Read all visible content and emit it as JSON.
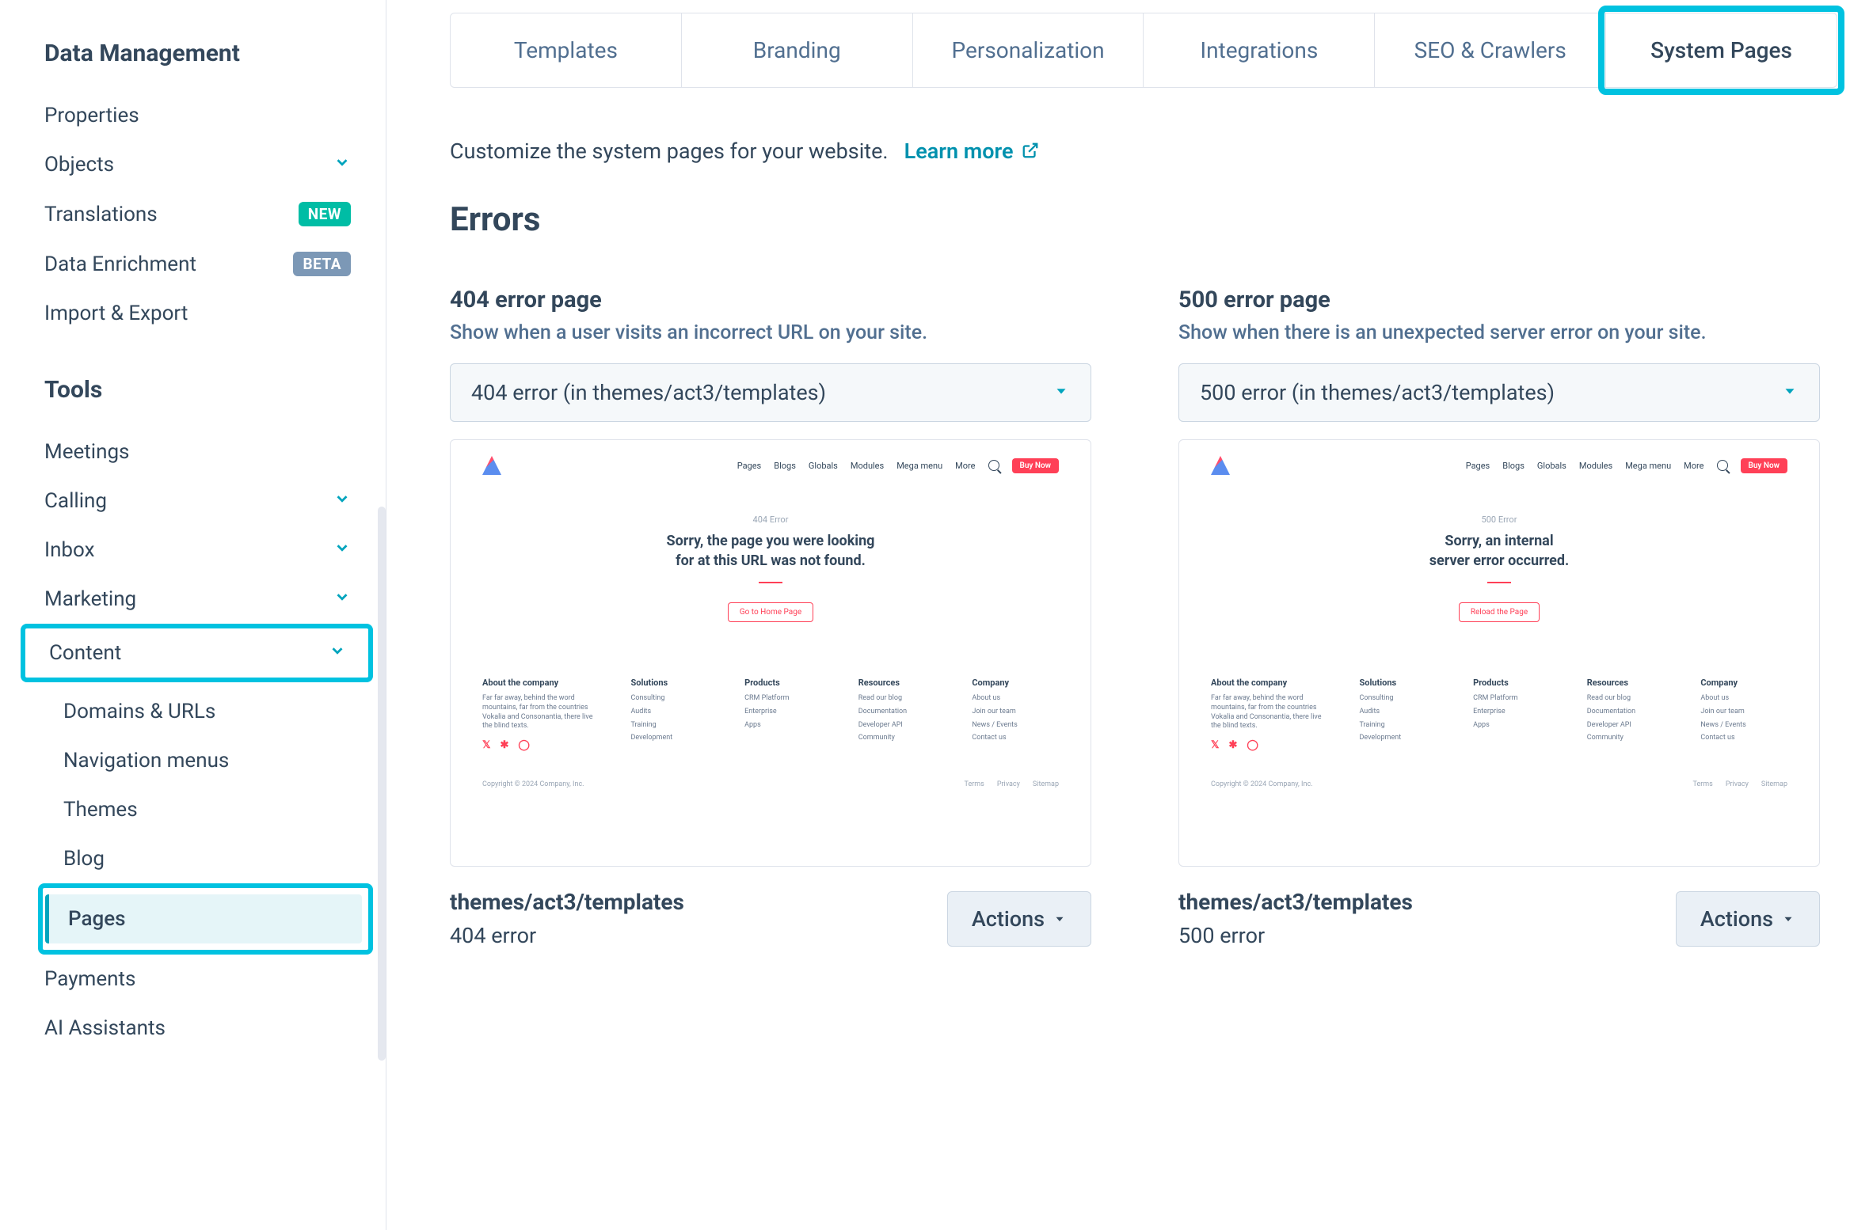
{
  "sidebar": {
    "section1_heading": "Data Management",
    "items1": {
      "properties": "Properties",
      "objects": "Objects",
      "translations": "Translations",
      "translations_badge": "NEW",
      "data_enrichment": "Data Enrichment",
      "data_enrichment_badge": "BETA",
      "import_export": "Import & Export"
    },
    "section2_heading": "Tools",
    "items2": {
      "meetings": "Meetings",
      "calling": "Calling",
      "inbox": "Inbox",
      "marketing": "Marketing",
      "content": "Content",
      "payments": "Payments",
      "ai_assistants": "AI Assistants"
    },
    "content_sub": {
      "domains": "Domains & URLs",
      "navmenus": "Navigation menus",
      "themes": "Themes",
      "blog": "Blog",
      "pages": "Pages"
    }
  },
  "tabs": {
    "templates": "Templates",
    "branding": "Branding",
    "personalization": "Personalization",
    "integrations": "Integrations",
    "seo": "SEO & Crawlers",
    "system_pages": "System Pages"
  },
  "main": {
    "description": "Customize the system pages for your website.",
    "learn_more": "Learn more",
    "heading": "Errors"
  },
  "card404": {
    "title": "404 error page",
    "subtitle": "Show when a user visits an incorrect URL on your site.",
    "select_value": "404 error (in themes/act3/templates)",
    "preview": {
      "nav": [
        "Pages",
        "Blogs",
        "Globals",
        "Modules",
        "Mega menu",
        "More"
      ],
      "buy": "Buy Now",
      "err_label": "404 Error",
      "err_title_line1": "Sorry, the page you were looking",
      "err_title_line2": "for at this URL was not found.",
      "btn": "Go to Home Page",
      "about_h": "About the company",
      "about_text": "Far far away, behind the word mountains, far from the countries Vokalia and Consonantia, there live the blind texts.",
      "col_solutions_h": "Solutions",
      "col_solutions": [
        "Consulting",
        "Audits",
        "Training",
        "Development"
      ],
      "col_products_h": "Products",
      "col_products": [
        "CRM Platform",
        "Enterprise",
        "Apps"
      ],
      "col_resources_h": "Resources",
      "col_resources": [
        "Read our blog",
        "Documentation",
        "Developer API",
        "Community"
      ],
      "col_company_h": "Company",
      "col_company": [
        "About us",
        "Join our team",
        "News / Events",
        "Contact us"
      ],
      "copyright": "Copyright © 2024 Company, Inc.",
      "footer_links": [
        "Terms",
        "Privacy",
        "Sitemap"
      ]
    },
    "footer_path": "themes/act3/templates",
    "footer_name": "404 error",
    "actions": "Actions"
  },
  "card500": {
    "title": "500 error page",
    "subtitle": "Show when there is an unexpected server error on your site.",
    "select_value": "500 error (in themes/act3/templates)",
    "preview": {
      "nav": [
        "Pages",
        "Blogs",
        "Globals",
        "Modules",
        "Mega menu",
        "More"
      ],
      "buy": "Buy Now",
      "err_label": "500 Error",
      "err_title_line1": "Sorry, an internal",
      "err_title_line2": "server error occurred.",
      "btn": "Reload the Page",
      "about_h": "About the company",
      "about_text": "Far far away, behind the word mountains, far from the countries Vokalia and Consonantia, there live the blind texts.",
      "col_solutions_h": "Solutions",
      "col_solutions": [
        "Consulting",
        "Audits",
        "Training",
        "Development"
      ],
      "col_products_h": "Products",
      "col_products": [
        "CRM Platform",
        "Enterprise",
        "Apps"
      ],
      "col_resources_h": "Resources",
      "col_resources": [
        "Read our blog",
        "Documentation",
        "Developer API",
        "Community"
      ],
      "col_company_h": "Company",
      "col_company": [
        "About us",
        "Join our team",
        "News / Events",
        "Contact us"
      ],
      "copyright": "Copyright © 2024 Company, Inc.",
      "footer_links": [
        "Terms",
        "Privacy",
        "Sitemap"
      ]
    },
    "footer_path": "themes/act3/templates",
    "footer_name": "500 error",
    "actions": "Actions"
  },
  "colors": {
    "teal": "#00a4bd",
    "highlight": "#00c2e0"
  }
}
